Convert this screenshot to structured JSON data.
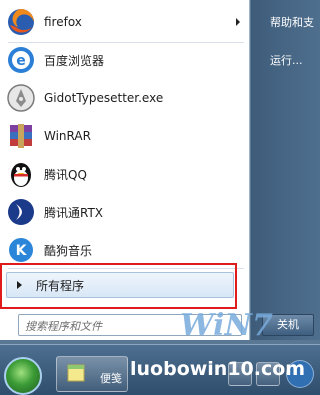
{
  "start_menu": {
    "programs": [
      {
        "label": "firefox",
        "icon": "firefox-icon",
        "has_submenu": true
      },
      {
        "label": "百度浏览器",
        "icon": "baidu-browser-icon",
        "has_submenu": false
      },
      {
        "label": "GidotTypesetter.exe",
        "icon": "gidot-icon",
        "has_submenu": false
      },
      {
        "label": "WinRAR",
        "icon": "winrar-icon",
        "has_submenu": false
      },
      {
        "label": "腾讯QQ",
        "icon": "qq-penguin-icon",
        "has_submenu": false
      },
      {
        "label": "腾讯通RTX",
        "icon": "rtx-icon",
        "has_submenu": false
      },
      {
        "label": "酷狗音乐",
        "icon": "kugou-icon",
        "has_submenu": false
      }
    ],
    "all_programs_label": "所有程序",
    "search_placeholder": "搜索程序和文件",
    "right_items": [
      "帮助和支",
      "运行..."
    ],
    "shutdown_label": "关机"
  },
  "taskbar": {
    "pinned_label": "便笺"
  },
  "watermark": {
    "text": "luobowin10.com",
    "logo": "WiN7"
  },
  "colors": {
    "highlight_frame": "#e01b1b",
    "menu_bg": "#ffffff",
    "right_panel": "#4a6a8a"
  }
}
